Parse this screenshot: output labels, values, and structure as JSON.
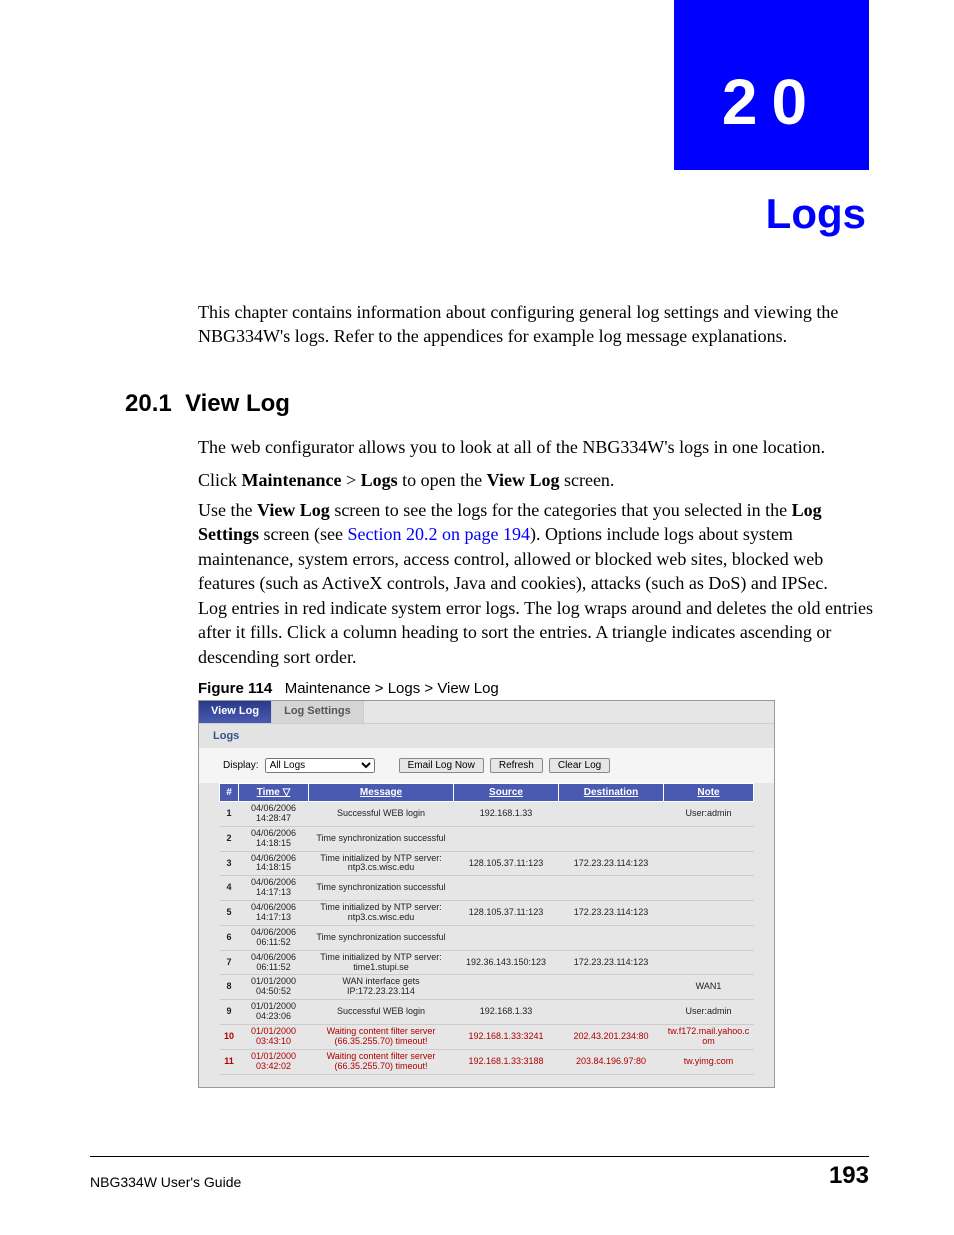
{
  "chapter": {
    "number": "20",
    "title": "Logs"
  },
  "intro": "This chapter contains information about configuring general log settings and viewing the NBG334W's logs. Refer to the appendices for example log message explanations.",
  "section": {
    "number": "20.1",
    "title": "View Log"
  },
  "para1": "The web configurator allows you to look at all of the NBG334W's logs in one location.",
  "para2": {
    "a": "Click ",
    "b": "Maintenance",
    "c": " > ",
    "d": "Logs",
    "e": " to open the ",
    "f": "View Log",
    "g": " screen."
  },
  "para3": {
    "a": "Use the ",
    "b": "View Log",
    "c": " screen to see the logs for the categories that you selected in the ",
    "d": "Log Settings",
    "e": " screen (see ",
    "link": "Section 20.2 on page 194",
    "f": "). Options include logs about system maintenance, system errors, access control, allowed or blocked web sites, blocked web features (such as ActiveX controls, Java and cookies), attacks (such as DoS) and IPSec."
  },
  "para4": "Log entries in red indicate system error logs. The log wraps around and deletes the old entries after it fills. Click a column heading to sort the entries. A triangle indicates ascending or descending sort order.",
  "figure": {
    "label": "Figure 114",
    "caption": "Maintenance > Logs > View Log"
  },
  "tabs": {
    "active": "View Log",
    "other": "Log Settings"
  },
  "panel_title": "Logs",
  "controls": {
    "display_label": "Display:",
    "display_value": "All Logs",
    "btn_email": "Email Log Now",
    "btn_refresh": "Refresh",
    "btn_clear": "Clear Log"
  },
  "columns": {
    "num": "#",
    "time": "Time ▽",
    "message": "Message",
    "source": "Source",
    "destination": "Destination",
    "note": "Note"
  },
  "rows": [
    {
      "n": "1",
      "time": "04/06/2006 14:28:47",
      "msg": "Successful WEB login",
      "src": "192.168.1.33",
      "dst": "",
      "note": "User:admin",
      "red": false
    },
    {
      "n": "2",
      "time": "04/06/2006 14:18:15",
      "msg": "Time synchronization successful",
      "src": "",
      "dst": "",
      "note": "",
      "red": false
    },
    {
      "n": "3",
      "time": "04/06/2006 14:18:15",
      "msg": "Time initialized by NTP server: ntp3.cs.wisc.edu",
      "src": "128.105.37.11:123",
      "dst": "172.23.23.114:123",
      "note": "",
      "red": false
    },
    {
      "n": "4",
      "time": "04/06/2006 14:17:13",
      "msg": "Time synchronization successful",
      "src": "",
      "dst": "",
      "note": "",
      "red": false
    },
    {
      "n": "5",
      "time": "04/06/2006 14:17:13",
      "msg": "Time initialized by NTP server: ntp3.cs.wisc.edu",
      "src": "128.105.37.11:123",
      "dst": "172.23.23.114:123",
      "note": "",
      "red": false
    },
    {
      "n": "6",
      "time": "04/06/2006 06:11:52",
      "msg": "Time synchronization successful",
      "src": "",
      "dst": "",
      "note": "",
      "red": false
    },
    {
      "n": "7",
      "time": "04/06/2006 06:11:52",
      "msg": "Time initialized by NTP server: time1.stupi.se",
      "src": "192.36.143.150:123",
      "dst": "172.23.23.114:123",
      "note": "",
      "red": false
    },
    {
      "n": "8",
      "time": "01/01/2000 04:50:52",
      "msg": "WAN interface gets IP:172.23.23.114",
      "src": "",
      "dst": "",
      "note": "WAN1",
      "red": false
    },
    {
      "n": "9",
      "time": "01/01/2000 04:23:06",
      "msg": "Successful WEB login",
      "src": "192.168.1.33",
      "dst": "",
      "note": "User:admin",
      "red": false
    },
    {
      "n": "10",
      "time": "01/01/2000 03:43:10",
      "msg": "Waiting content filter server (66.35.255.70) timeout!",
      "src": "192.168.1.33:3241",
      "dst": "202.43.201.234:80",
      "note": "tw.f172.mail.yahoo.com",
      "red": true
    },
    {
      "n": "11",
      "time": "01/01/2000 03:42:02",
      "msg": "Waiting content filter server (66.35.255.70) timeout!",
      "src": "192.168.1.33:3188",
      "dst": "203.84.196.97:80",
      "note": "tw.yimg.com",
      "red": true
    }
  ],
  "footer": {
    "left": "NBG334W User's Guide",
    "right": "193"
  }
}
